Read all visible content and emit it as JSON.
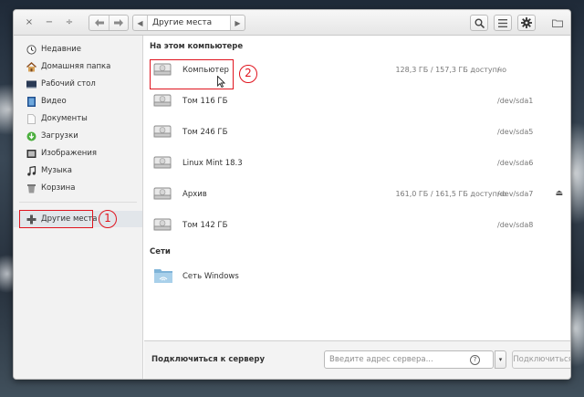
{
  "window": {
    "controls": {
      "close": "×",
      "minimize": "−",
      "maximize": "÷"
    },
    "path": {
      "current": "Другие места"
    }
  },
  "sidebar": {
    "items": [
      {
        "label": "Недавние",
        "icon": "clock-icon"
      },
      {
        "label": "Домашняя папка",
        "icon": "home-icon"
      },
      {
        "label": "Рабочий стол",
        "icon": "desktop-icon"
      },
      {
        "label": "Видео",
        "icon": "video-icon"
      },
      {
        "label": "Документы",
        "icon": "document-icon"
      },
      {
        "label": "Загрузки",
        "icon": "download-icon"
      },
      {
        "label": "Изображения",
        "icon": "image-icon"
      },
      {
        "label": "Музыка",
        "icon": "music-icon"
      },
      {
        "label": "Корзина",
        "icon": "trash-icon"
      }
    ],
    "other_places": {
      "label": "Другие места",
      "icon": "plus-icon"
    }
  },
  "main": {
    "computer_section": {
      "title": "На этом компьютере",
      "rows": [
        {
          "name": "Компьютер",
          "usage": "128,3 ГБ / 157,3 ГБ доступно",
          "device": "/"
        },
        {
          "name": "Том 116 ГБ",
          "usage": "",
          "device": "/dev/sda1"
        },
        {
          "name": "Том 246 ГБ",
          "usage": "",
          "device": "/dev/sda5"
        },
        {
          "name": "Linux Mint 18.3",
          "usage": "",
          "device": "/dev/sda6"
        },
        {
          "name": "Архив",
          "usage": "161,0 ГБ / 161,5 ГБ доступно",
          "device": "/dev/sda7",
          "eject": "⏏"
        },
        {
          "name": "Том 142 ГБ",
          "usage": "",
          "device": "/dev/sda8"
        }
      ]
    },
    "network_section": {
      "title": "Сети",
      "rows": [
        {
          "name": "Сеть Windows"
        }
      ]
    }
  },
  "connect_bar": {
    "label": "Подключиться к серверу",
    "placeholder": "Введите адрес сервера...",
    "help": "?",
    "dropdown": "▾",
    "button": "Подключиться"
  },
  "annotations": {
    "marker_1": "1",
    "marker_2": "2"
  },
  "colors": {
    "annotation_red": "#e0141e",
    "folder_blue": "#7fb4d8"
  }
}
